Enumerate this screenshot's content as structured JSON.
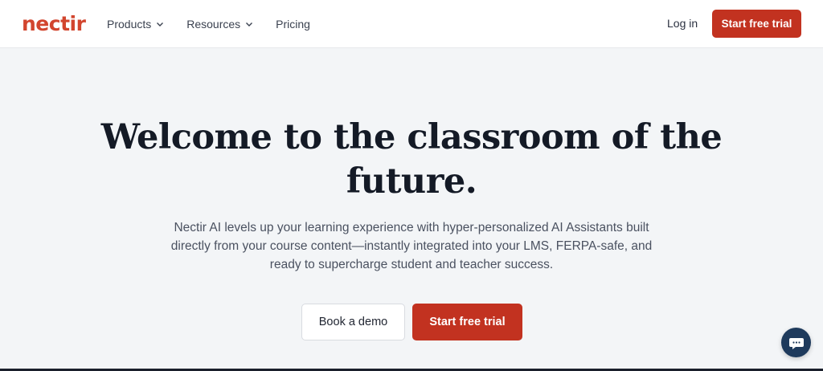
{
  "header": {
    "logo_text": "nectir",
    "nav": [
      {
        "label": "Products",
        "has_dropdown": true
      },
      {
        "label": "Resources",
        "has_dropdown": true
      },
      {
        "label": "Pricing",
        "has_dropdown": false
      }
    ],
    "login_label": "Log in",
    "cta_label": "Start free trial"
  },
  "hero": {
    "title": "Welcome to the classroom of the future.",
    "subtitle": "Nectir AI levels up your learning experience with hyper-personalized AI Assistants built directly from your course content—instantly integrated into your LMS, FERPA-safe, and ready to supercharge student and teacher success.",
    "demo_label": "Book a demo",
    "trial_label": "Start free trial"
  },
  "chat_widget": {
    "icon": "chat-icon"
  },
  "colors": {
    "brand": "#d2452e",
    "primary_button": "#c23220",
    "background": "#f3f5f7",
    "chat": "#1e3a5c"
  }
}
